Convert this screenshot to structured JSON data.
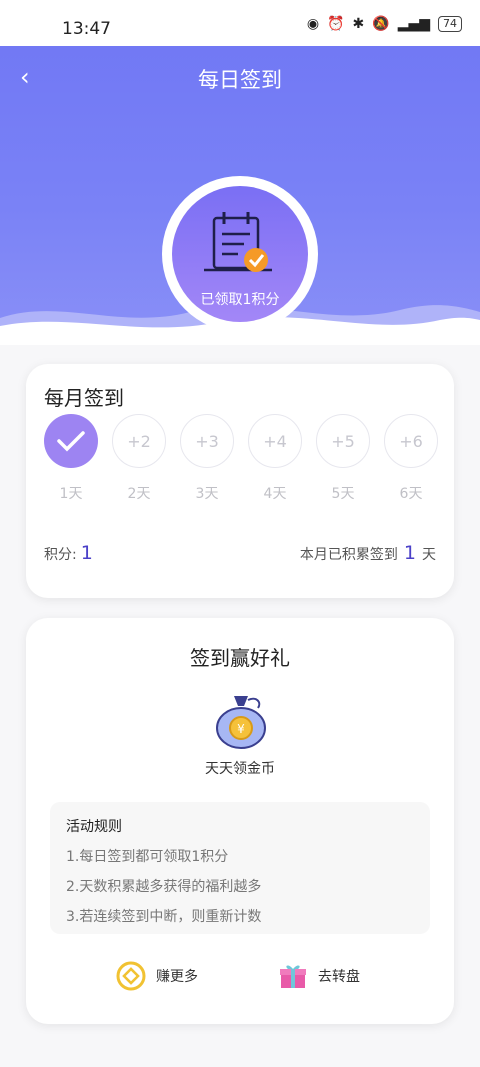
{
  "status": {
    "time": "13:47",
    "battery": "74"
  },
  "header": {
    "title": "每日签到",
    "badge_text": "已领取1积分"
  },
  "monthly": {
    "title": "每月签到",
    "days": [
      {
        "bonus": "",
        "label": "1天",
        "checked": true
      },
      {
        "bonus": "+2",
        "label": "2天",
        "checked": false
      },
      {
        "bonus": "+3",
        "label": "3天",
        "checked": false
      },
      {
        "bonus": "+4",
        "label": "4天",
        "checked": false
      },
      {
        "bonus": "+5",
        "label": "5天",
        "checked": false
      },
      {
        "bonus": "+6",
        "label": "6天",
        "checked": false
      }
    ],
    "points_label": "积分:",
    "points_value": "1",
    "cumulative_prefix": "本月已积累签到",
    "cumulative_value": "1",
    "cumulative_suffix": "天"
  },
  "rewards": {
    "title": "签到赢好礼",
    "coin_label": "天天领金币",
    "rules_title": "活动规则",
    "rules": [
      "1.每日签到都可领取1积分",
      "2.天数积累越多获得的福利越多",
      "3.若连续签到中断，则重新计数"
    ],
    "earn_more": "赚更多",
    "go_wheel": "去转盘"
  },
  "colors": {
    "header": "#6f76f4",
    "accent": "#4b40c8",
    "checked_day": "#9d84f2"
  },
  "icons": [
    "back-icon",
    "calendar-check-icon",
    "money-bag-icon",
    "coin-icon",
    "gift-icon"
  ]
}
